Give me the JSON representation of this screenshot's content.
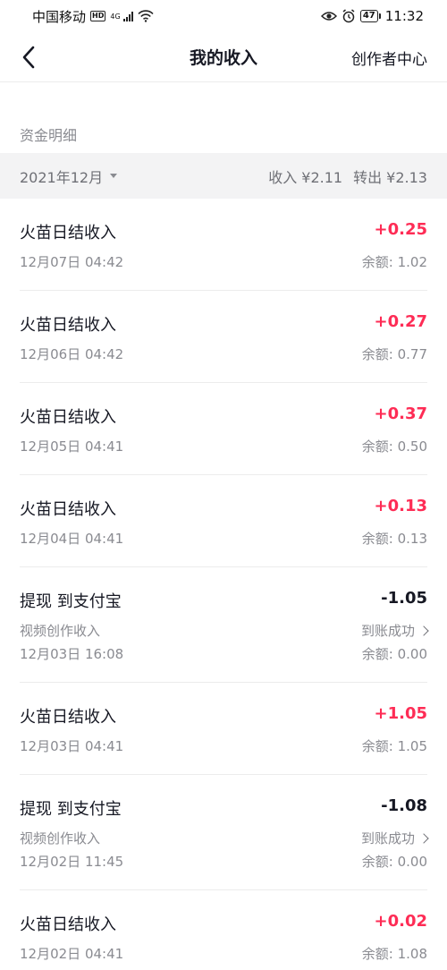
{
  "status_bar": {
    "carrier": "中国移动",
    "hd": "HD",
    "network": "4G",
    "battery": "47",
    "time": "11:32"
  },
  "nav": {
    "title": "我的收入",
    "right_link": "创作者中心"
  },
  "section_label": "资金明细",
  "filter": {
    "month": "2021年12月",
    "income": "收入 ¥2.11",
    "transfer_out": "转出 ¥2.13"
  },
  "transactions": [
    {
      "type": "simple",
      "title": "火苗日结收入",
      "amount": "+0.25",
      "sign": "positive",
      "time": "12月07日 04:42",
      "balance": "余额: 1.02"
    },
    {
      "type": "simple",
      "title": "火苗日结收入",
      "amount": "+0.27",
      "sign": "positive",
      "time": "12月06日 04:42",
      "balance": "余额: 0.77"
    },
    {
      "type": "simple",
      "title": "火苗日结收入",
      "amount": "+0.37",
      "sign": "positive",
      "time": "12月05日 04:41",
      "balance": "余额: 0.50"
    },
    {
      "type": "simple",
      "title": "火苗日结收入",
      "amount": "+0.13",
      "sign": "positive",
      "time": "12月04日 04:41",
      "balance": "余额: 0.13"
    },
    {
      "type": "withdraw",
      "title": "提现 到支付宝",
      "amount": "-1.05",
      "sign": "negative",
      "source": "视频创作收入",
      "status": "到账成功",
      "time": "12月03日 16:08",
      "balance": "余额: 0.00"
    },
    {
      "type": "simple",
      "title": "火苗日结收入",
      "amount": "+1.05",
      "sign": "positive",
      "time": "12月03日 04:41",
      "balance": "余额: 1.05"
    },
    {
      "type": "withdraw",
      "title": "提现 到支付宝",
      "amount": "-1.08",
      "sign": "negative",
      "source": "视频创作收入",
      "status": "到账成功",
      "time": "12月02日 11:45",
      "balance": "余额: 0.00"
    },
    {
      "type": "simple",
      "title": "火苗日结收入",
      "amount": "+0.02",
      "sign": "positive",
      "time": "12月02日 04:41",
      "balance": "余额: 1.08"
    }
  ],
  "colors": {
    "accent_positive": "#fe2c55",
    "text_primary": "#161823",
    "text_secondary": "#8a8b91",
    "filter_bg": "#f3f3f4"
  }
}
